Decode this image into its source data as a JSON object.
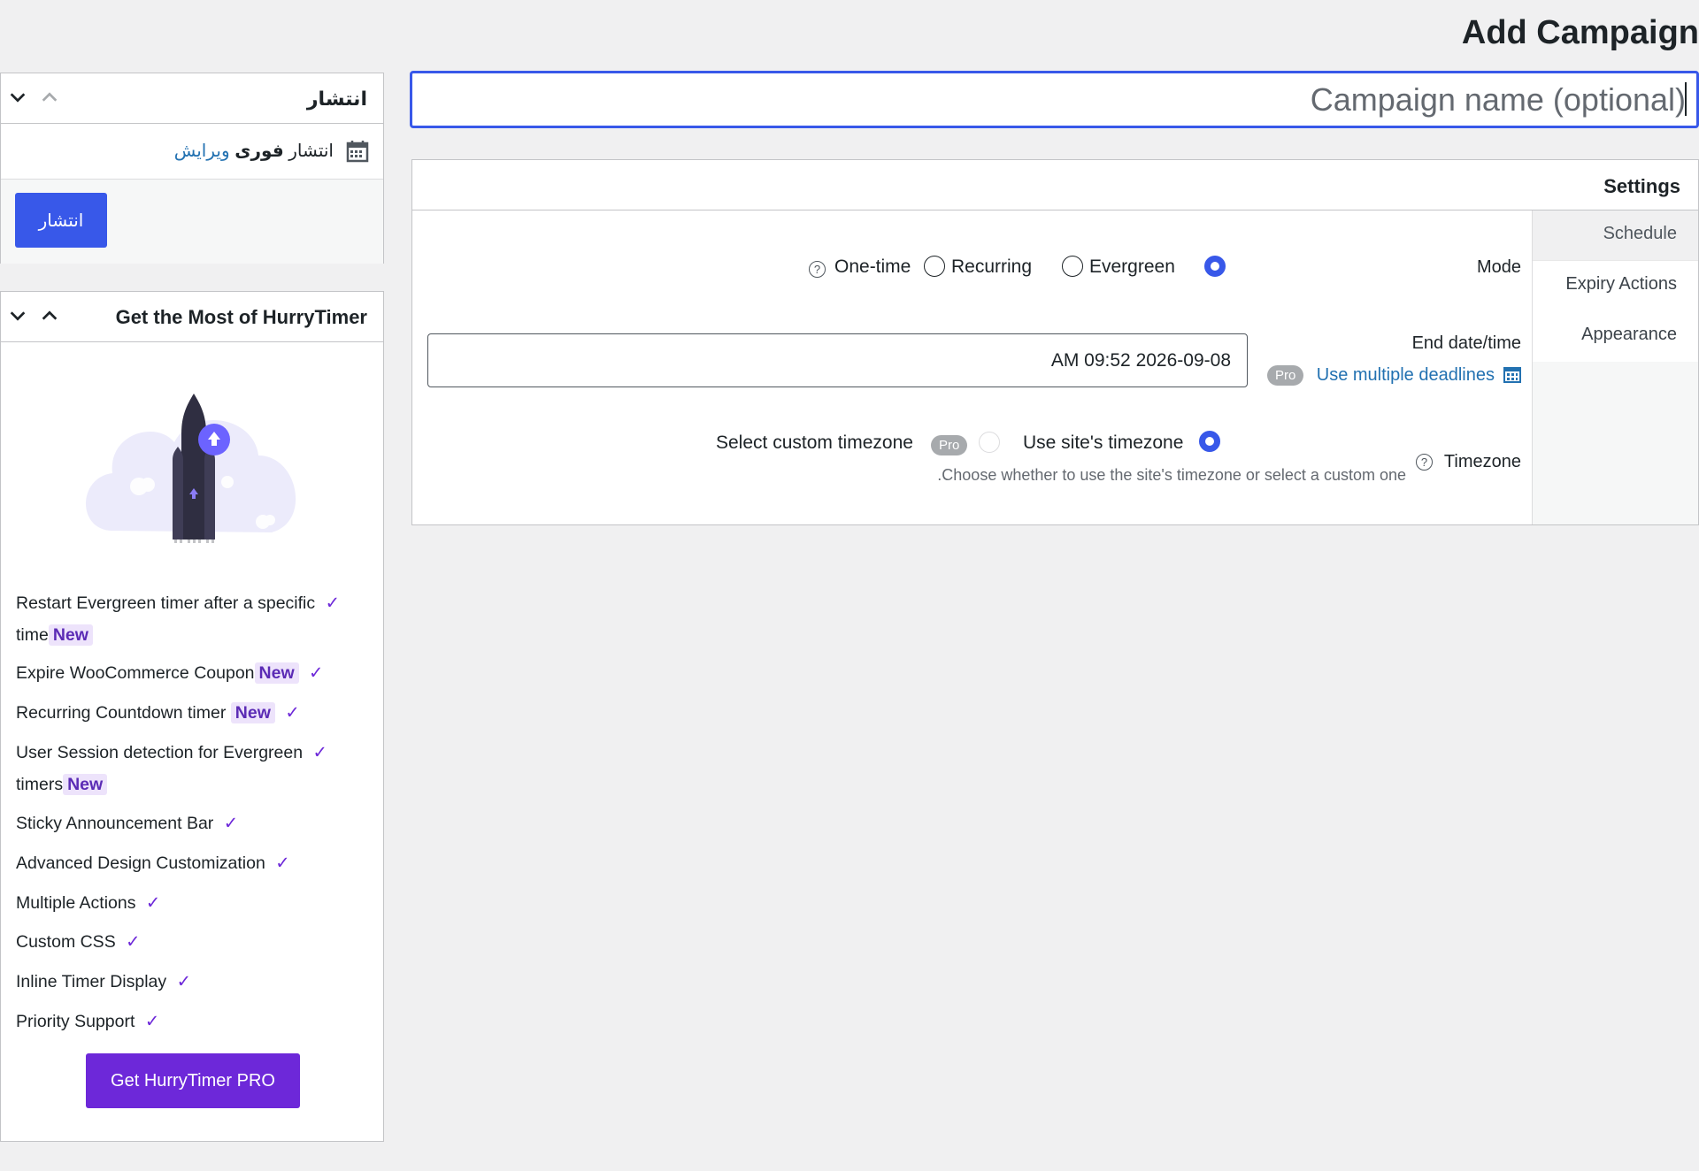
{
  "page": {
    "title": "Add Campaign"
  },
  "campaign_name": {
    "value": "",
    "placeholder": "Campaign name (optional)"
  },
  "publish_box": {
    "title": "انتشار",
    "status_prefix": "انتشار",
    "status_bold": "فوری",
    "edit_link": "ویرایش",
    "button": "انتشار"
  },
  "settings": {
    "title": "Settings",
    "tabs": [
      {
        "label": "Schedule",
        "active": true
      },
      {
        "label": "Expiry Actions"
      },
      {
        "label": "Appearance"
      }
    ],
    "mode": {
      "label": "Mode",
      "options": [
        "Evergreen",
        "Recurring",
        "One-time"
      ],
      "help_icon": "?"
    },
    "end_datetime": {
      "label": "End date/time",
      "value": "2026-09-08 09:52 AM",
      "pro_badge": "Pro",
      "multiple_link": "Use multiple deadlines"
    },
    "timezone": {
      "label": "Timezone",
      "help_icon": "?",
      "site_option": "Use site's timezone",
      "custom_option": "Select custom timezone",
      "pro_badge": "Pro",
      "description": "Choose whether to use the site's timezone or select a custom one."
    }
  },
  "promo_box": {
    "title": "Get the Most of HurryTimer",
    "features": [
      {
        "line1": "Restart Evergreen timer after a specific",
        "line2": "time",
        "new": "New"
      },
      {
        "text": "Expire WooCommerce Coupon",
        "new": "New"
      },
      {
        "text": "Recurring Countdown timer",
        "new": "New"
      },
      {
        "line1": "User Session detection for Evergreen",
        "line2": "timers",
        "new": "New"
      },
      {
        "text": "Sticky Announcement Bar"
      },
      {
        "text": "Advanced Design Customization"
      },
      {
        "text": "Multiple Actions"
      },
      {
        "text": "Custom CSS"
      },
      {
        "text": "Inline Timer Display"
      },
      {
        "text": "Priority Support"
      }
    ],
    "check": "✓",
    "button": "Get HurryTimer PRO"
  },
  "colors": {
    "accent": "#3858e9",
    "pro_purple": "#6d28d9",
    "link": "#2271b1"
  }
}
